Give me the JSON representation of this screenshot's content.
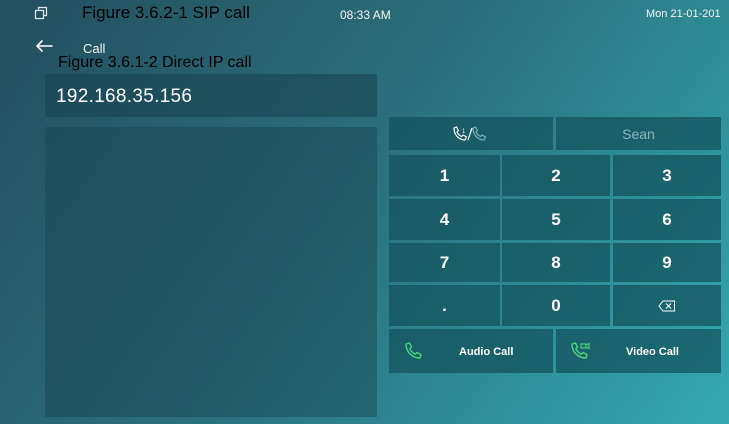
{
  "status_bar": {
    "time": "08:33 AM",
    "date": "Mon   21-01-201",
    "window_icon": "window-restore-icon"
  },
  "captions": {
    "sip_call": "Figure 3.6.2-1 SIP call",
    "direct_ip_call": "Figure 3.6.1-2 Direct IP call"
  },
  "header": {
    "back_icon": "back-arrow-icon",
    "title": "Call"
  },
  "dial_input": {
    "value": "192.168.35.156"
  },
  "top_buttons": {
    "mode_icon": "call-mode-toggle-icon",
    "contact_name": "Sean"
  },
  "keypad": {
    "keys": [
      "1",
      "2",
      "3",
      "4",
      "5",
      "6",
      "7",
      "8",
      "9",
      ".",
      "0"
    ],
    "delete_icon": "backspace-icon"
  },
  "call_buttons": {
    "audio_label": "Audio Call",
    "audio_icon": "phone-icon",
    "video_label": "Video Call",
    "video_icon": "video-phone-icon"
  },
  "colors": {
    "background_start": "#234f5f",
    "background_end": "#34a9b2",
    "button": "#12505c",
    "call_icon_green": "#4fd47a",
    "muted_text": "#8fb5bc"
  }
}
